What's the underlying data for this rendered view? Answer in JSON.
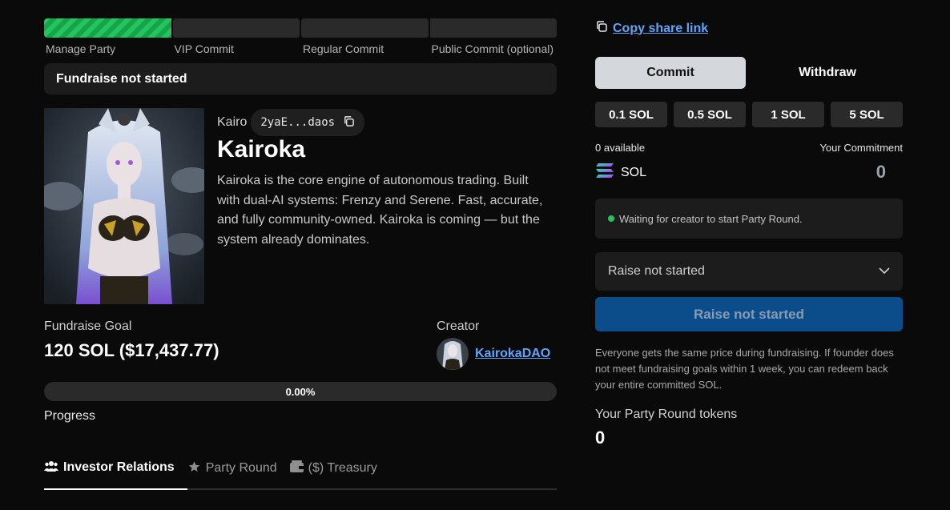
{
  "steps": [
    {
      "label": "Manage Party",
      "active": true
    },
    {
      "label": "VIP Commit",
      "active": false
    },
    {
      "label": "Regular Commit",
      "active": false
    },
    {
      "label": "Public Commit (optional)",
      "active": false
    }
  ],
  "status_text": "Fundraise not started",
  "token": {
    "ticker": "Kairo",
    "address_short": "2yaE...daos",
    "name": "Kairoka",
    "description": "Kairoka is the core engine of autonomous trading. Built with dual-AI systems: Frenzy and Serene. Fast, accurate, and fully community-owned. Kairoka is coming — but the system already dominates."
  },
  "fundraise": {
    "goal_label": "Fundraise Goal",
    "goal_value": "120 SOL ($17,437.77)",
    "creator_label": "Creator",
    "creator_name": "KairokaDAO",
    "progress_text": "0.00%",
    "progress_fraction": 0,
    "progress_label": "Progress"
  },
  "tabs": [
    {
      "label": "Investor Relations",
      "icon": "users-icon",
      "active": true
    },
    {
      "label": "Party Round",
      "icon": "star-icon",
      "active": false
    },
    {
      "label": "($) Treasury",
      "icon": "wallet-icon",
      "active": false
    }
  ],
  "panel": {
    "share_label": "Copy share link",
    "commit_label": "Commit",
    "withdraw_label": "Withdraw",
    "amounts": [
      "0.1 SOL",
      "0.5 SOL",
      "1 SOL",
      "5 SOL"
    ],
    "available": "0 available",
    "your_commitment_label": "Your Commitment",
    "currency": "SOL",
    "commitment_value": "0",
    "waiting_text": "Waiting for creator to start Party Round.",
    "select_value": "Raise not started",
    "action_label": "Raise not started",
    "note": "Everyone gets the same price during fundraising. If founder does not meet fundraising goals within 1 week, you can redeem back your entire committed SOL.",
    "tokens_label": "Your Party Round tokens",
    "tokens_value": "0"
  },
  "colors": {
    "accent_green": "#22c55e",
    "link_blue": "#60a5fa",
    "button_blue": "#0a4d8a",
    "background": "#0a0a0a"
  }
}
